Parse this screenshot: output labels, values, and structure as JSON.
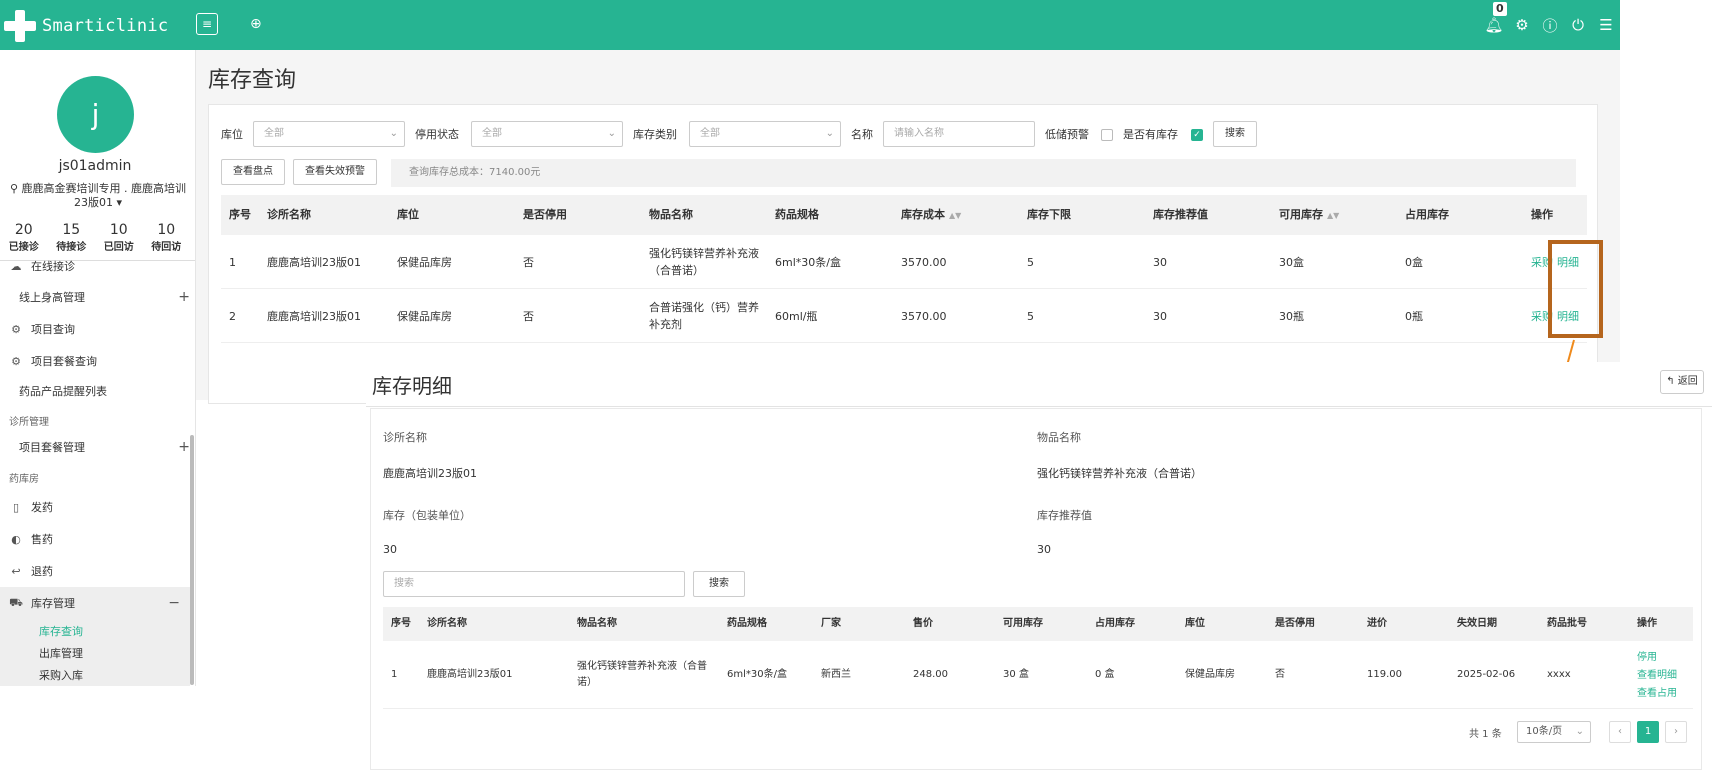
{
  "app": {
    "name": "Smarticlinic",
    "menu_toggle": "≡",
    "add_tab": "⊕",
    "notification_count": "0"
  },
  "user": {
    "avatar_letter": "j",
    "name": "js01admin",
    "clinic": "鹿鹿高金赛培训专用 . 鹿鹿高培训23版01",
    "stats": [
      {
        "num": "20",
        "label": "已接诊"
      },
      {
        "num": "15",
        "label": "待接诊"
      },
      {
        "num": "10",
        "label": "已回访"
      },
      {
        "num": "10",
        "label": "待回访"
      }
    ]
  },
  "sidebar": {
    "online_reception": "在线接诊",
    "height_mgmt": "线上身高管理",
    "project_query": "项目查询",
    "package_query": "项目套餐查询",
    "drug_reminder": "药品产品提醒列表",
    "clinic_mgmt_section": "诊所管理",
    "package_mgmt": "项目套餐管理",
    "pharmacy_section": "药库房",
    "dispense": "发药",
    "sell": "售药",
    "return_drug": "退药",
    "inventory_mgmt": "库存管理",
    "sub": {
      "inventory_query": "库存查询",
      "outbound": "出库管理",
      "purchase_in": "采购入库"
    }
  },
  "main": {
    "title": "库存查询",
    "filters": {
      "location_label": "库位",
      "location_value": "全部",
      "disabled_label": "停用状态",
      "disabled_value": "全部",
      "category_label": "库存类别",
      "category_value": "全部",
      "name_label": "名称",
      "name_placeholder": "请输入名称",
      "low_stock_label": "低储预警",
      "has_stock_label": "是否有库存",
      "search_btn": "搜索"
    },
    "view_inventory_btn": "查看盘点",
    "view_expiry_btn": "查看失效预警",
    "total_cost": "查询库存总成本：7140.00元",
    "columns": [
      "序号",
      "诊所名称",
      "库位",
      "是否停用",
      "物品名称",
      "药品规格",
      "库存成本",
      "库存下限",
      "库存推荐值",
      "可用库存",
      "占用库存",
      "操作"
    ],
    "rows": [
      {
        "no": "1",
        "clinic": "鹿鹿高培训23版01",
        "location": "保健品库房",
        "disabled": "否",
        "item": "强化钙镁锌营养补充液（合普诺）",
        "spec": "6ml*30条/盒",
        "cost": "3570.00",
        "min": "5",
        "recommend": "30",
        "available": "30盒",
        "occupied": "0盒",
        "op1": "采购",
        "op2": "明细"
      },
      {
        "no": "2",
        "clinic": "鹿鹿高培训23版01",
        "location": "保健品库房",
        "disabled": "否",
        "item": "合普诺强化（钙）营养补充剂",
        "spec": "60ml/瓶",
        "cost": "3570.00",
        "min": "5",
        "recommend": "30",
        "available": "30瓶",
        "occupied": "0瓶",
        "op1": "采购",
        "op2": "明细"
      }
    ]
  },
  "detail": {
    "title": "库存明细",
    "back_btn": "返回",
    "clinic_label": "诊所名称",
    "clinic_value": "鹿鹿高培训23版01",
    "item_label": "物品名称",
    "item_value": "强化钙镁锌营养补充液（合普诺）",
    "stock_label": "库存（包装单位）",
    "stock_value": "30",
    "recommend_label": "库存推荐值",
    "recommend_value": "30",
    "search_placeholder": "搜索",
    "search_btn": "搜索",
    "columns": [
      "序号",
      "诊所名称",
      "物品名称",
      "药品规格",
      "厂家",
      "售价",
      "可用库存",
      "占用库存",
      "库位",
      "是否停用",
      "进价",
      "失效日期",
      "药品批号",
      "操作"
    ],
    "row": {
      "no": "1",
      "clinic": "鹿鹿高培训23版01",
      "item": "强化钙镁锌营养补充液（合普诺）",
      "spec": "6ml*30条/盒",
      "maker": "新西兰",
      "price": "248.00",
      "available": "30 盒",
      "occupied": "0 盒",
      "location": "保健品库房",
      "disabled": "否",
      "cost": "119.00",
      "expiry": "2025-02-06",
      "batch": "xxxx",
      "op1": "停用",
      "op2": "查看明细",
      "op3": "查看占用"
    },
    "pager": {
      "total": "共 1 条",
      "page_size": "10条/页",
      "current": "1"
    }
  }
}
